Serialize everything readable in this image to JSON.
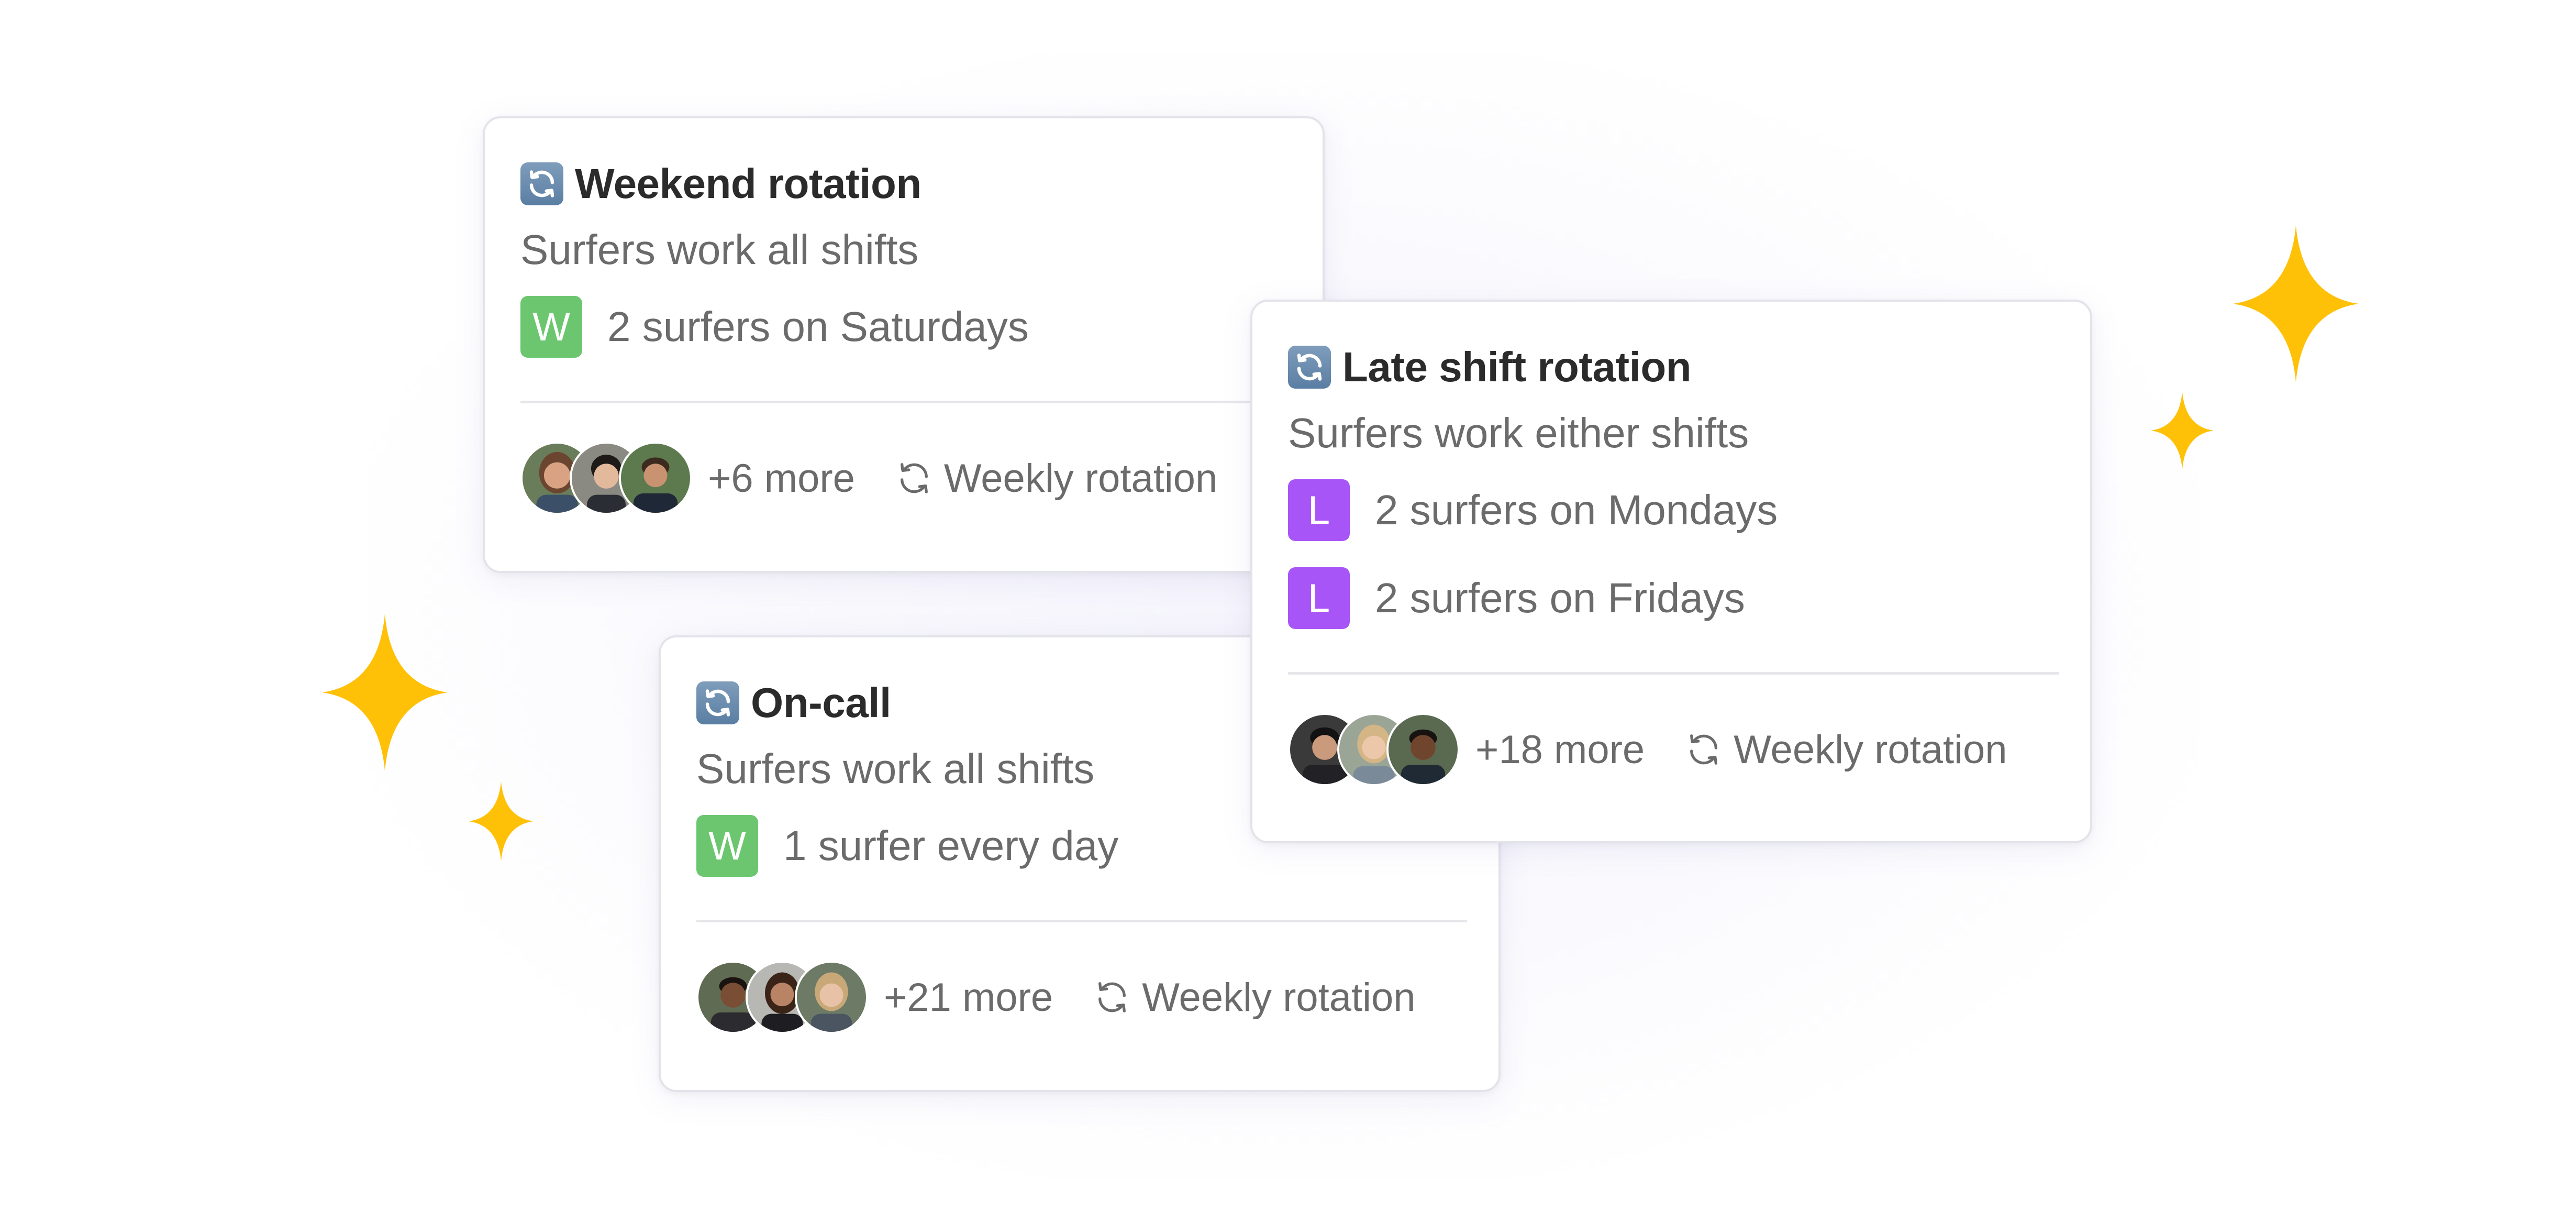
{
  "colors": {
    "sparkle": "#FFC107",
    "badge_weekend": "#6CC66F",
    "badge_late": "#A855F7",
    "title_text": "#2B2B2B",
    "body_text": "#6B6B6B"
  },
  "cards": [
    {
      "icon": "rotation-emoji-icon",
      "title": "Weekend rotation",
      "description": "Surfers work all shifts",
      "shifts": [
        {
          "badge": "W",
          "badge_color": "#6CC66F",
          "text": "2 surfers on Saturdays"
        }
      ],
      "more": "+6 more",
      "rotation": "Weekly rotation"
    },
    {
      "icon": "rotation-emoji-icon",
      "title": "On-call",
      "description": "Surfers work all shifts",
      "shifts": [
        {
          "badge": "W",
          "badge_color": "#6CC66F",
          "text": "1 surfer every day"
        }
      ],
      "more": "+21 more",
      "rotation": "Weekly rotation"
    },
    {
      "icon": "rotation-emoji-icon",
      "title": "Late shift rotation",
      "description": "Surfers work either shifts",
      "shifts": [
        {
          "badge": "L",
          "badge_color": "#A855F7",
          "text": "2 surfers on Mondays"
        },
        {
          "badge": "L",
          "badge_color": "#A855F7",
          "text": "2 surfers on Fridays"
        }
      ],
      "more": "+18 more",
      "rotation": "Weekly rotation"
    }
  ]
}
